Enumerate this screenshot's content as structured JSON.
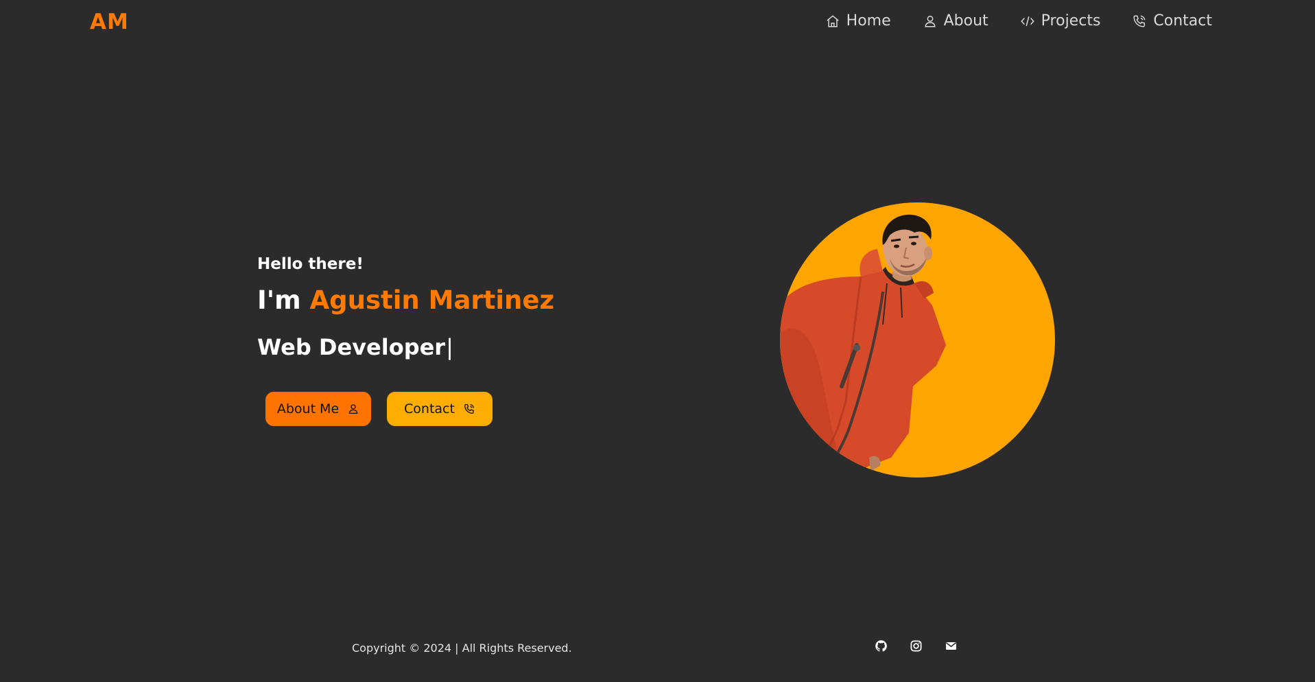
{
  "header": {
    "logo": "AM",
    "nav": [
      {
        "label": "Home",
        "icon": "home-icon"
      },
      {
        "label": "About",
        "icon": "user-icon"
      },
      {
        "label": "Projects",
        "icon": "code-icon"
      },
      {
        "label": "Contact",
        "icon": "phone-icon"
      }
    ]
  },
  "hero": {
    "greeting": "Hello there!",
    "intro": "I'm",
    "name": "Agustin Martinez",
    "role": "Web Developer",
    "cursor": "|",
    "buttons": {
      "about_label": "About Me",
      "contact_label": "Contact"
    }
  },
  "footer": {
    "copyright": "Copyright © 2024 | All Rights Reserved.",
    "socials": [
      "github-icon",
      "instagram-icon",
      "mail-icon"
    ]
  },
  "colors": {
    "background": "#2b2b2b",
    "accent": "#ff7a00",
    "button_secondary": "#ffad00",
    "avatar_bg": "#ffa500"
  }
}
